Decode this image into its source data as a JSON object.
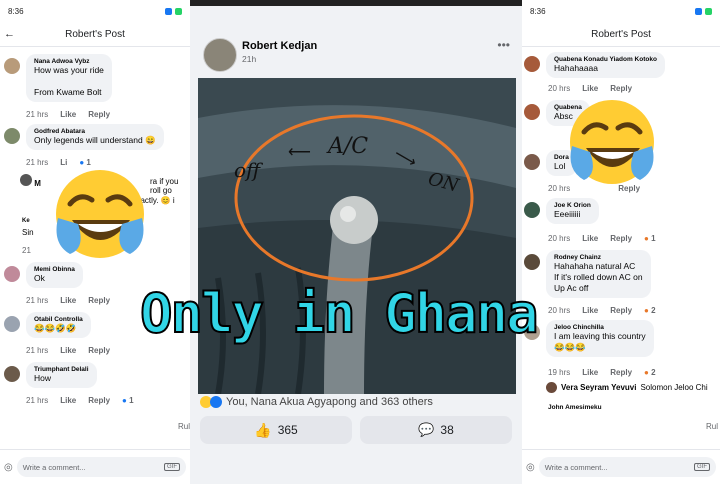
{
  "left": {
    "time": "8:36",
    "battery": "9(",
    "title": "Robert's Post",
    "comments": [
      {
        "name": "Nana Adwoa Vybz",
        "text": "How was your ride\n\nFrom Kwame Bolt",
        "time": "21 hrs",
        "like": "Like",
        "reply": "Reply"
      },
      {
        "name": "Godfred Abatara",
        "text": "Only legends will understand 😄",
        "time": "21 hrs",
        "like": "Li",
        "reply": "",
        "count": "1"
      },
      {
        "name": "Memi Obinna",
        "text": "Ok",
        "time": "21 hrs",
        "like": "Like",
        "reply": "Reply"
      },
      {
        "name": "Otabil Controlla",
        "text": "😂😂🤣🤣",
        "time": "21 hrs",
        "like": "Like",
        "reply": "Reply"
      },
      {
        "name": "Triumphant Delali",
        "text": "How",
        "time": "21 hrs",
        "like": "Like",
        "reply": "Reply",
        "count": "1"
      }
    ],
    "partial_reply": "ra if you roll go",
    "partial_reply2": "exactly. 😊 i",
    "partial_sin": "Sin",
    "partial_21": "21",
    "partial_ke": "Ke",
    "partial_m": "M",
    "rul": "Rul",
    "write_placeholder": "Write a comment...",
    "gif": "GIF"
  },
  "center": {
    "poster_name": "Robert Kedjan",
    "time": "21h",
    "more": "•••",
    "photo_text": {
      "off": "off",
      "ac": "A/C",
      "on": "ON"
    },
    "reactions_text": "You, Nana Akua Agyapong and 363 others",
    "like_count": "365",
    "comment_count": "38"
  },
  "right": {
    "time": "8:36",
    "battery": "9(",
    "title": "Robert's Post",
    "comments": [
      {
        "name": "Quabena Konadu Yiadom Kotoko",
        "text": "Hahahaaaa",
        "time": "20 hrs",
        "like": "Like",
        "reply": "Reply"
      },
      {
        "name": "Quabena",
        "text": "Absc",
        "time": "",
        "like": "",
        "reply": ""
      },
      {
        "name": "Dora",
        "text": "Lol",
        "time": "20 hrs",
        "like": "",
        "reply": "Reply"
      },
      {
        "name": "Joe K Orion",
        "text": "Eeeiiiiii",
        "time": "20 hrs",
        "like": "Like",
        "reply": "Reply",
        "count": "1"
      },
      {
        "name": "Rodney Chainz",
        "text": "Hahahaha natural AC\nIf it's rolled down AC on\nUp Ac off",
        "time": "20 hrs",
        "like": "Like",
        "reply": "Reply",
        "count": "2"
      },
      {
        "name": "Jeloo Chinchilla",
        "text": "I am leaving this country\n😂😂😂",
        "time": "19 hrs",
        "like": "Like",
        "reply": "Reply",
        "count": "2"
      }
    ],
    "reply_line": {
      "name": "Vera Seyram Yevuvi",
      "text": "Solomon Jeloo Chi"
    },
    "last_name": "John Amesimeku",
    "rul": "Rul",
    "write_placeholder": "Write a comment...",
    "gif": "GIF"
  },
  "overlay_caption": "Only in Ghana",
  "colors": {
    "fb_blue": "#1877f2",
    "caption": "#31d5e6",
    "emoji_yellow": "#ffcc33",
    "tear_blue": "#5aa9e6",
    "circle_orange": "#e8782a"
  }
}
